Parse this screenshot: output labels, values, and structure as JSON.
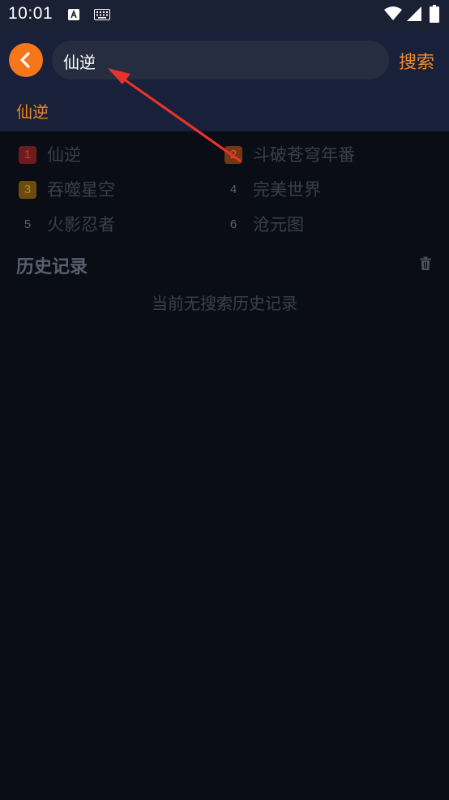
{
  "status_bar": {
    "time": "10:01",
    "icons": [
      "a-notification-icon",
      "keyboard-icon",
      "wifi-icon",
      "signal-icon",
      "battery-icon"
    ]
  },
  "header": {
    "back_icon": "chevron-left-icon",
    "search_value": "仙逆",
    "search_button_label": "搜索",
    "accent_color": "#f5771a"
  },
  "suggestions": [
    {
      "label": "仙逆"
    }
  ],
  "hot_search": [
    {
      "rank": "1",
      "title": "仙逆"
    },
    {
      "rank": "2",
      "title": "斗破苍穹年番"
    },
    {
      "rank": "3",
      "title": "吞噬星空"
    },
    {
      "rank": "4",
      "title": "完美世界"
    },
    {
      "rank": "5",
      "title": "火影忍者"
    },
    {
      "rank": "6",
      "title": "沧元图"
    }
  ],
  "history": {
    "title": "历史记录",
    "clear_icon": "trash-icon",
    "empty_text": "当前无搜索历史记录"
  },
  "annotation": {
    "type": "red-arrow",
    "color": "#e8322c"
  }
}
